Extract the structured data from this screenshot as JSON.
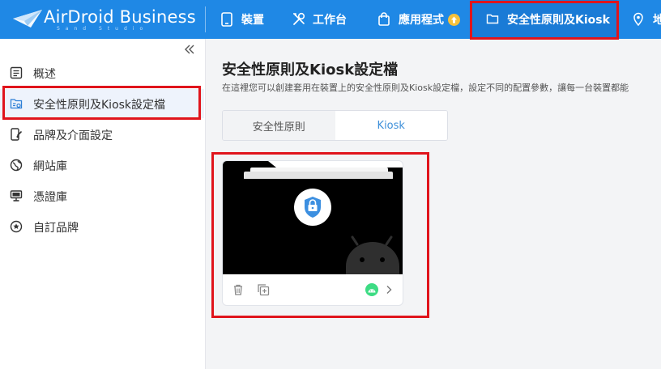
{
  "app": {
    "brand": "AirDroid Business",
    "sub_brand": "Sand Studio"
  },
  "topnav": {
    "items": [
      {
        "label": "裝置",
        "icon": "tablet-icon"
      },
      {
        "label": "工作台",
        "icon": "tools-icon"
      },
      {
        "label": "應用程式",
        "icon": "shopping-bag-icon",
        "badge": "update-arrow-icon"
      },
      {
        "label": "安全性原則及Kiosk",
        "icon": "folder-icon",
        "active": true
      },
      {
        "label": "地",
        "icon": "map-pin-icon"
      }
    ]
  },
  "sidebar": {
    "collapse_icon": "double-chevron-left-icon",
    "items": [
      {
        "label": "概述",
        "icon": "list-doc-icon"
      },
      {
        "label": "安全性原則及Kiosk設定檔",
        "icon": "folder-settings-icon",
        "active": true
      },
      {
        "label": "品牌及介面設定",
        "icon": "phone-brush-icon"
      },
      {
        "label": "網站庫",
        "icon": "globe-icon"
      },
      {
        "label": "憑證庫",
        "icon": "certificate-icon"
      },
      {
        "label": "自訂品牌",
        "icon": "star-circle-icon"
      }
    ]
  },
  "main": {
    "title": "安全性原則及Kiosk設定檔",
    "description": "在這裡您可以創建套用在裝置上的安全性原則及Kiosk設定檔，設定不同的配置參數，讓每一台裝置都能",
    "tabs": [
      {
        "label": "安全性原則",
        "active": false
      },
      {
        "label": "Kiosk",
        "active": true
      }
    ],
    "card": {
      "lock_icon": "shield-lock-icon",
      "platform_icon": "android-icon",
      "actions": [
        "trash-icon",
        "duplicate-icon"
      ],
      "status_icon": "android-badge-icon",
      "chevron": "chevron-right-icon"
    }
  },
  "colors": {
    "primary": "#1f88e5",
    "highlight": "#e0141c",
    "tab_active_text": "#3d8fd9",
    "android_green": "#3ddc84"
  }
}
